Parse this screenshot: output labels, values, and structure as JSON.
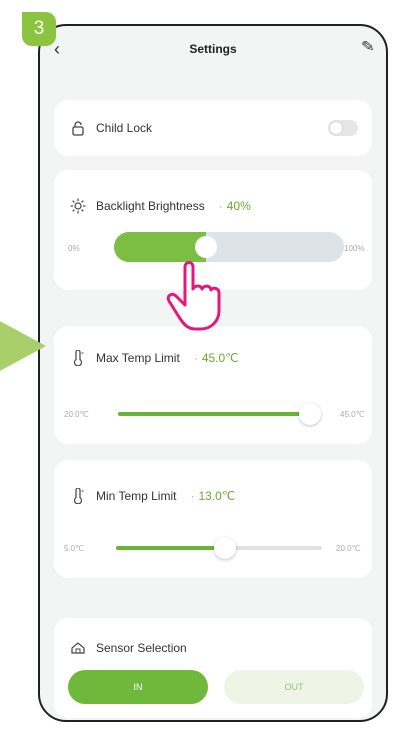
{
  "step_badge": "3",
  "header": {
    "title": "Settings",
    "back_icon": "chevron-left-icon",
    "edit_icon": "pencil-icon"
  },
  "child_lock": {
    "label": "Child Lock",
    "icon": "lock-icon",
    "enabled": false
  },
  "backlight": {
    "label": "Backlight Brightness",
    "separator": "·",
    "value": "40%",
    "level_percent": 40,
    "min": "0%",
    "max": "100%",
    "icon": "sun-icon"
  },
  "max_temp": {
    "label": "Max Temp Limit",
    "separator": "·",
    "value": "45.0℃",
    "level_fraction": 0.95,
    "min": "20.0℃",
    "max": "45.0℃",
    "icon": "thermometer-icon"
  },
  "min_temp": {
    "label": "Min Temp Limit",
    "separator": "·",
    "value": "13.0℃",
    "level_fraction": 0.53,
    "min": "5.0℃",
    "max": "20.0℃",
    "icon": "thermometer-icon"
  },
  "sensor": {
    "label": "Sensor Selection",
    "icon": "sensor-icon",
    "options": [
      "IN",
      "OUT"
    ],
    "selected": "IN"
  },
  "colors": {
    "accent": "#7cbd43",
    "badge": "#8dc43f",
    "arrow": "#a8cf6a"
  }
}
